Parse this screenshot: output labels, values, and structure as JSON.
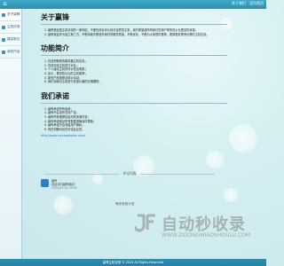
{
  "topbar": {
    "home_glyph": "⌂",
    "links": [
      "关于我们",
      "设为首页"
    ]
  },
  "sidebar": {
    "items": [
      {
        "label": "关于赢锋",
        "icon": "home-icon",
        "active": true
      },
      {
        "label": "主机评测",
        "icon": "monitor-icon",
        "active": false
      },
      {
        "label": "建站笔记",
        "icon": "note-icon",
        "active": false
      },
      {
        "label": "我的作品",
        "icon": "folder-icon",
        "active": false
      }
    ]
  },
  "about": {
    "title": "关于赢锋",
    "items": [
      "赢锋是经营主机评测的一家网站，不断在综合评价找寻优质的主机，我们希望给所有我们的用户带来性价比更高的资源。",
      "赢锋保证作为独立第三方，不断持续不断提升我们的服务质量，不断优化，不断为大家提供推荐，更新更好更有优势的主机信息。"
    ]
  },
  "features": {
    "title": "功能简介",
    "items": [
      "在线获取新的服务器主机信息；",
      "在线评测主机进行对比；",
      "个人建站主机的评价信息收集；",
      "定价，更具性价比的主机推荐；",
      "新的产品推荐及特价活动；",
      "我们持续对主机进行优惠价格的长期跟踪。"
    ]
  },
  "promise": {
    "title": "我们承诺",
    "items": [
      "赢锋承诺所有免费；",
      "赢锋不会发布任何广告；",
      "赢锋所有推荐信息均有来源可查；",
      "赢锋承诺保证所有数据准确及时更新；",
      "赢锋承诺不会泄露用户隐私；",
      "有任何疑问请在评论区反馈。"
    ],
    "link": "http://www.xxxxwebsite.com/"
  },
  "comments": {
    "divider_label": "评论列表",
    "entry": {
      "name": "赢锋",
      "text": "欢迎访问赢锋网站！",
      "time": "2024-03-12 09:34"
    },
    "sofa_text": "等你来抢沙发"
  },
  "watermark": {
    "main": "自动秒收录",
    "sub": "WWW.ZIDONGMIAOSHOULU.COM"
  },
  "footer": {
    "text": "赢锋主机评测 © 2024  All Rights Reserved"
  },
  "colors": {
    "accent": "#2e8fb0",
    "link": "#2a76b8"
  }
}
